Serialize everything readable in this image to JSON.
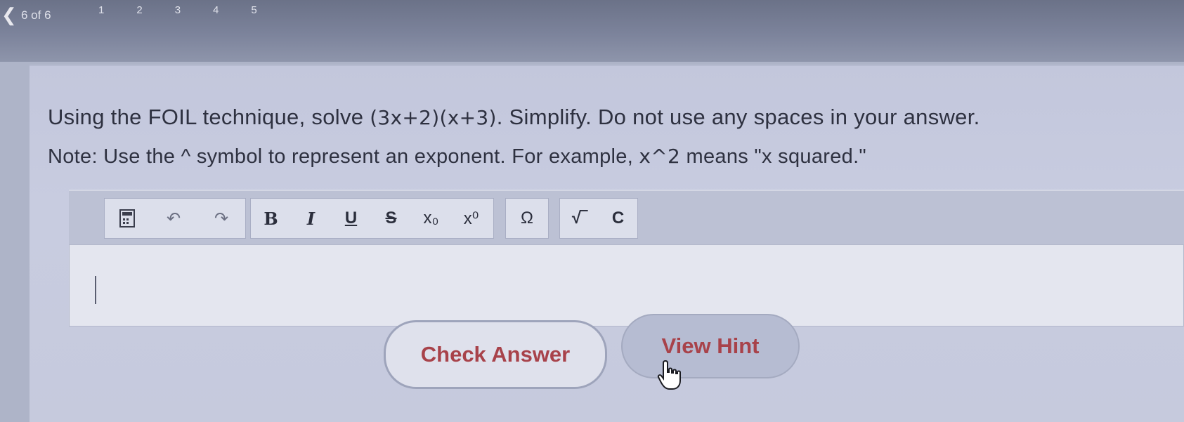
{
  "nav": {
    "back_glyph": "❮",
    "position_text": "6 of 6",
    "numbers": [
      "1",
      "2",
      "3",
      "4",
      "5"
    ]
  },
  "question": {
    "line1_prefix": "Using the FOIL technique, solve ",
    "line1_expr": "(3x+2)(x+3)",
    "line1_suffix": ". Simplify. Do not use any spaces in your answer.",
    "line2_prefix": "Note: Use the ^ symbol to represent an exponent. For example, ",
    "line2_expr": "x^2",
    "line2_suffix": " means \"x squared.\""
  },
  "toolbar": {
    "history_icon": "calculator-icon",
    "undo_glyph": "↶",
    "redo_glyph": "↷",
    "bold": "B",
    "italic": "I",
    "underline": "U",
    "strike": "S",
    "subscript": "x₀",
    "superscript": "x⁰",
    "omega": "Ω",
    "sqrt": "√‾",
    "clear": "C"
  },
  "answer": {
    "value": ""
  },
  "buttons": {
    "check_answer": "Check Answer",
    "view_hint": "View Hint"
  },
  "colors": {
    "button_text": "#a8424a",
    "card_bg": "#c6cadd",
    "topbar_bg": "#7c839b"
  }
}
